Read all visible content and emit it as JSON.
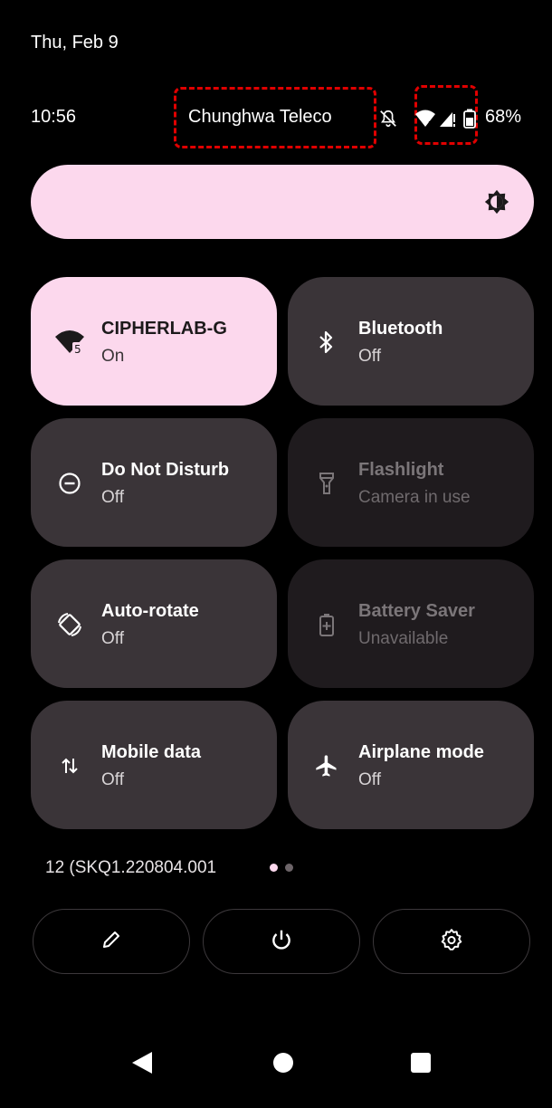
{
  "status": {
    "date": "Thu, Feb 9",
    "time": "10:56",
    "carrier": "Chunghwa Teleco",
    "battery": "68%"
  },
  "tiles": [
    {
      "label": "CIPHERLAB-G",
      "state": "On",
      "icon": "wifi-icon"
    },
    {
      "label": "Bluetooth",
      "state": "Off",
      "icon": "bluetooth-icon"
    },
    {
      "label": "Do Not Disturb",
      "state": "Off",
      "icon": "do-not-disturb-icon"
    },
    {
      "label": "Flashlight",
      "state": "Camera in use",
      "icon": "flashlight-icon"
    },
    {
      "label": "Auto-rotate",
      "state": "Off",
      "icon": "auto-rotate-icon"
    },
    {
      "label": "Battery Saver",
      "state": "Unavailable",
      "icon": "battery-saver-icon"
    },
    {
      "label": "Mobile data",
      "state": "Off",
      "icon": "mobile-data-icon"
    },
    {
      "label": "Airplane mode",
      "state": "Off",
      "icon": "airplane-icon"
    }
  ],
  "footer": {
    "build": "12 (SKQ1.220804.001"
  },
  "colors": {
    "accent": "#fcd8ed",
    "tile": "#3a3438",
    "tile_dim": "#1f1b1e"
  }
}
